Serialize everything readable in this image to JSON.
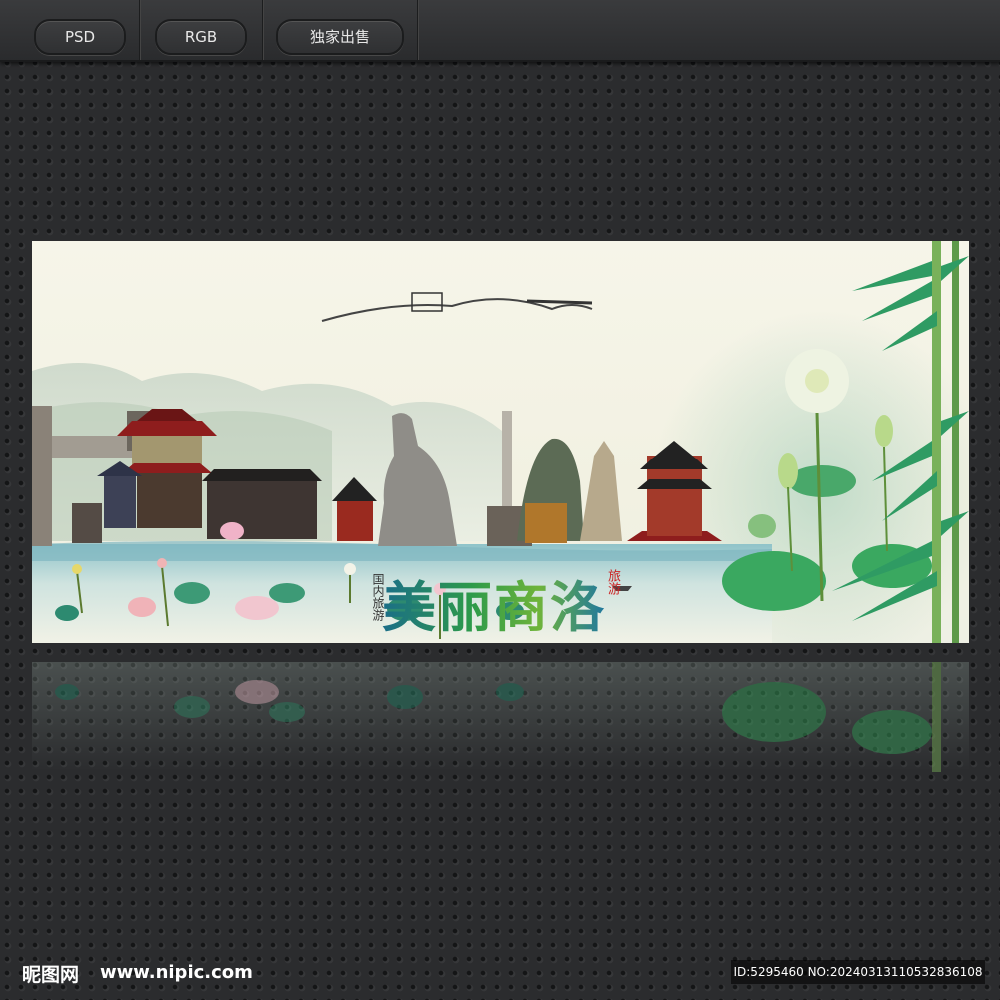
{
  "toolbar": {
    "badges": [
      "PSD",
      "RGB",
      "独家出售"
    ]
  },
  "banner": {
    "title": "美丽商洛",
    "side_text": "国内旅游",
    "seal_text": "旅游",
    "colors": {
      "title_green": "#2d9a4a",
      "title_blue": "#1b6e88",
      "bamboo": "#3aa860",
      "water": "#a9cfd0"
    }
  },
  "footer": {
    "logo": "昵图网",
    "url": "www.nipic.com",
    "id_text": "ID:5295460 NO:20240313110532836108"
  }
}
